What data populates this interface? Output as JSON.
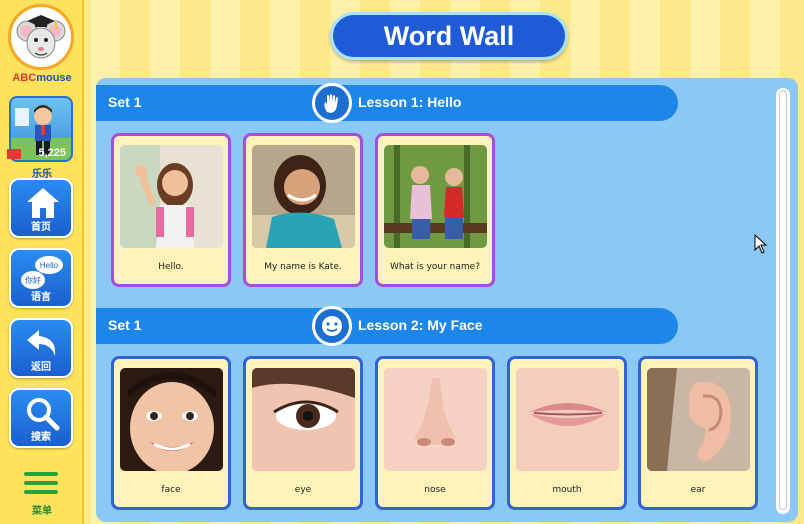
{
  "app": {
    "logo_prefix": "ABC",
    "logo_suffix": "mouse",
    "page_title": "Word Wall"
  },
  "user": {
    "score": "5,225",
    "name": "乐乐"
  },
  "nav": {
    "home_label": "首页",
    "language_label": "语言",
    "back_label": "返回",
    "search_label": "搜索",
    "menu_label": "菜单",
    "language_bubble_en": "Hello",
    "language_bubble_zh": "你好"
  },
  "lessons": [
    {
      "set": "Set 1",
      "title": "Lesson 1: Hello",
      "icon": "wave-hand-icon",
      "cards": [
        {
          "caption": "Hello.",
          "image": "girl-waving-photo"
        },
        {
          "caption": "My name is Kate.",
          "image": "smiling-girl-photo"
        },
        {
          "caption": "What is your name?",
          "image": "two-girls-talking-photo"
        }
      ]
    },
    {
      "set": "Set 1",
      "title": "Lesson 2: My Face",
      "icon": "face-icon",
      "cards": [
        {
          "caption": "face",
          "image": "child-face-photo"
        },
        {
          "caption": "eye",
          "image": "eye-photo"
        },
        {
          "caption": "nose",
          "image": "nose-photo"
        },
        {
          "caption": "mouth",
          "image": "mouth-photo"
        },
        {
          "caption": "ear",
          "image": "ear-photo"
        }
      ]
    }
  ],
  "colors": {
    "panel": "#8cc8f5",
    "lesson_bar": "#1c87e8",
    "card_bg": "#fdf3b8",
    "lesson1_border": "#a64de0",
    "lesson2_border": "#2f63d6",
    "title_pill": "#1f5bd6"
  }
}
